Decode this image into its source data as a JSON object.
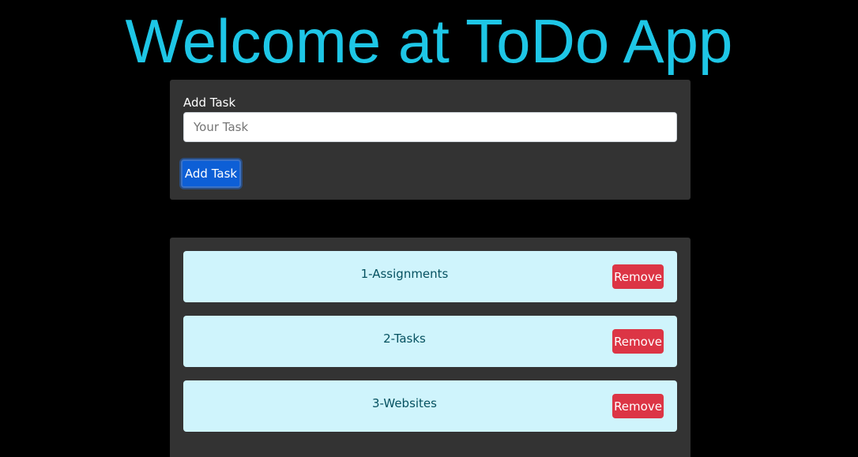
{
  "header": {
    "title": "Welcome at ToDo App"
  },
  "add_form": {
    "label": "Add Task",
    "input_value": "",
    "input_placeholder": "Your Task",
    "submit_label": "Add Task"
  },
  "tasks": [
    {
      "text": "1-Assignments",
      "remove_label": "Remove"
    },
    {
      "text": "2-Tasks",
      "remove_label": "Remove"
    },
    {
      "text": "3-Websites",
      "remove_label": "Remove"
    }
  ],
  "colors": {
    "background": "#000000",
    "title": "#1ec6e6",
    "card": "#333333",
    "primary": "#0d5fd6",
    "danger": "#dc3545",
    "task_bg": "#cff4fc",
    "task_text": "#055160"
  }
}
